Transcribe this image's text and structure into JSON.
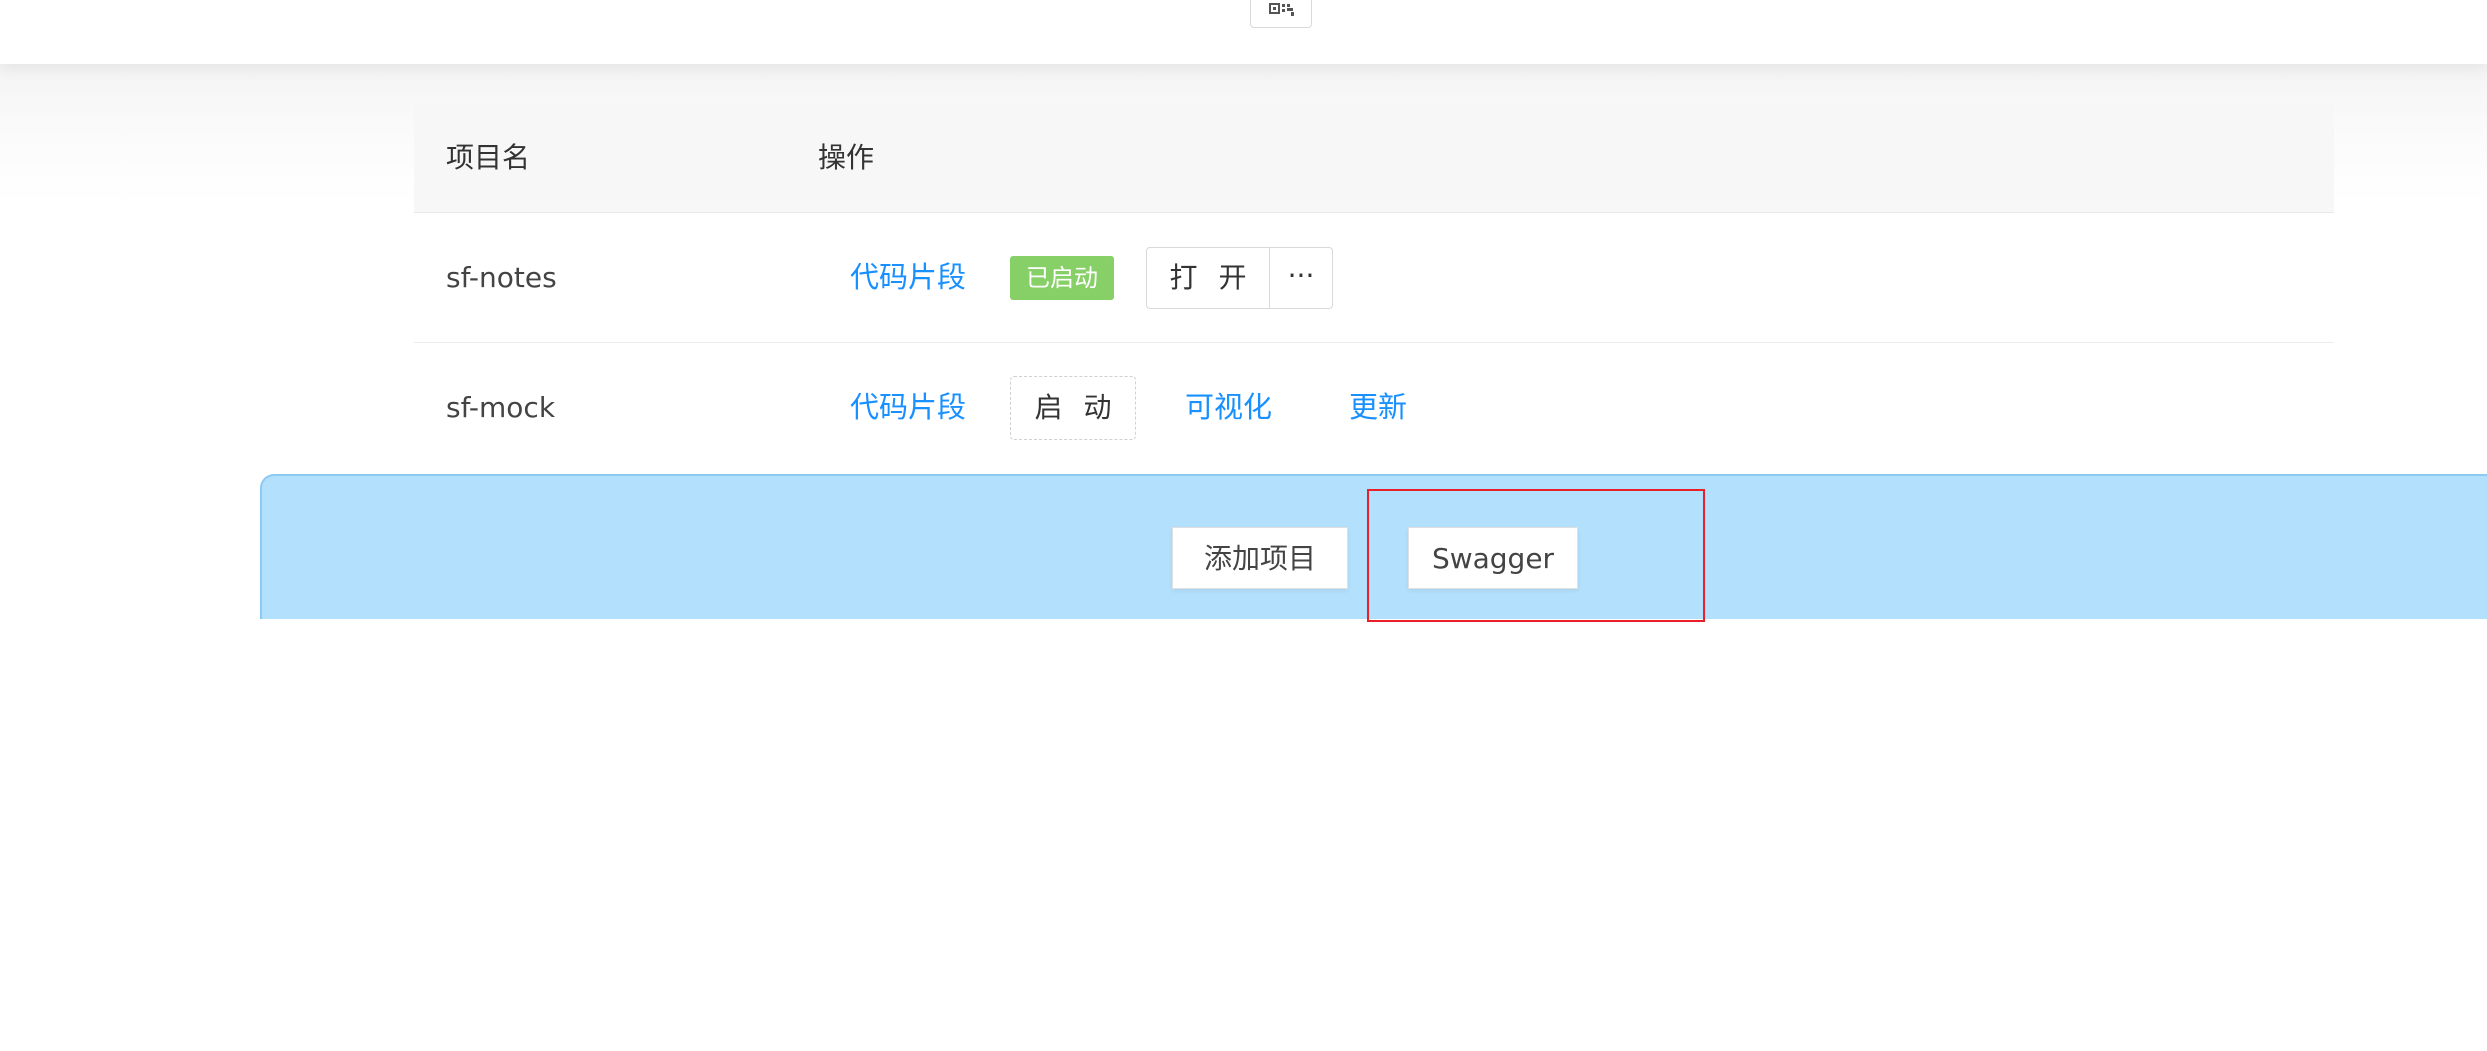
{
  "header": {
    "qr_icon": "qrcode-icon"
  },
  "table": {
    "columns": {
      "name": "项目名",
      "operation": "操作"
    },
    "rows": [
      {
        "name": "sf-notes",
        "snippet_link": "代码片段",
        "status_tag": "已启动",
        "open_button": "打 开",
        "more_button": "···"
      },
      {
        "name": "sf-mock",
        "snippet_link": "代码片段",
        "start_button": "启 动",
        "visualize_link": "可视化",
        "update_link": "更新"
      }
    ]
  },
  "footer": {
    "add_project_button": "添加项目",
    "swagger_button": "Swagger"
  },
  "colors": {
    "link": "#1890ff",
    "tag_green": "#87d068",
    "footer_bg": "#b3e0fc",
    "highlight": "#e8202a"
  }
}
